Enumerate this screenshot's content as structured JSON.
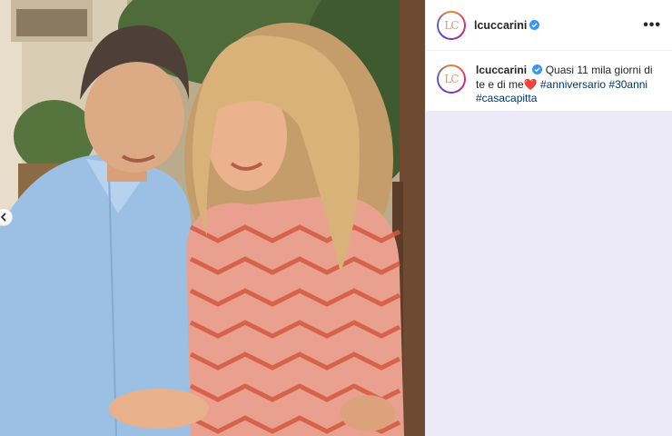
{
  "post": {
    "username": "lcuccarini",
    "avatar_monogram": "LC",
    "verified": true,
    "more_label": "•••"
  },
  "caption": {
    "username": "lcuccarini",
    "text": "Quasi 11 mila giorni di te e di me",
    "emoji": "❤️",
    "hashtags": [
      "#anniversario",
      "#30anni",
      "#casacapitta"
    ]
  },
  "colors": {
    "link": "#00376b",
    "verified_badge": "#3897f0",
    "comments_bg": "#eceaf9"
  }
}
